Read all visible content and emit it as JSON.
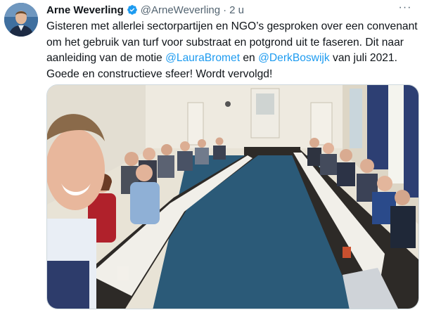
{
  "tweet": {
    "author_name": "Arne Weverling",
    "author_handle": "@ArneWeverling",
    "separator": "·",
    "timestamp": "2 u",
    "verified": true,
    "more_label": "···",
    "text_part1": "Gisteren met allerlei sectorpartijen en NGO’s gesproken over een convenant om het gebruik van turf voor substraat en potgrond uit te faseren. Dit naar aanleiding van de motie ",
    "mention1": "@LauraBromet",
    "text_part2": " en ",
    "mention2": "@DerkBoswijk",
    "text_part3": " van juli 2021. Goede en constructieve sfeer! Wordt vervolgd!"
  },
  "colors": {
    "link": "#1d9bf0",
    "verified_badge": "#1d9bf0",
    "secondary_text": "#536471",
    "primary_text": "#0f1419"
  },
  "icons": {
    "verified": "verified-badge-icon",
    "more": "more-options-icon"
  }
}
